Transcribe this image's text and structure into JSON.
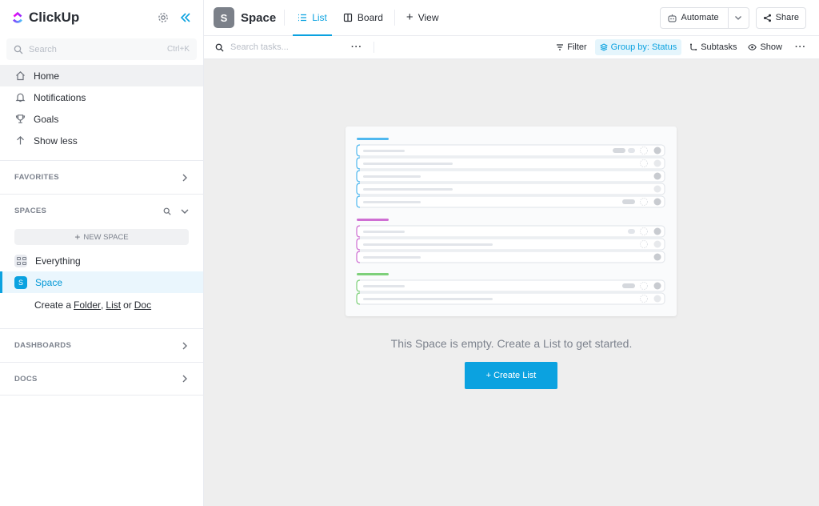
{
  "app": {
    "name": "ClickUp"
  },
  "sidebar": {
    "search_placeholder": "Search",
    "search_shortcut": "Ctrl+K",
    "nav": [
      {
        "label": "Home",
        "icon": "home-icon"
      },
      {
        "label": "Notifications",
        "icon": "bell-icon"
      },
      {
        "label": "Goals",
        "icon": "trophy-icon"
      },
      {
        "label": "Show less",
        "icon": "arrow-up-icon"
      }
    ],
    "favorites_label": "FAVORITES",
    "spaces_label": "SPACES",
    "new_space_label": "NEW SPACE",
    "spaces": [
      {
        "label": "Everything",
        "icon": "grid-icon"
      },
      {
        "label": "Space",
        "initial": "S"
      }
    ],
    "create_line": {
      "prefix": "Create a",
      "folder": "Folder",
      "comma": ",",
      "list": "List",
      "or": "or",
      "doc": "Doc"
    },
    "dashboards_label": "DASHBOARDS",
    "docs_label": "DOCS"
  },
  "header": {
    "space_initial": "S",
    "space_name": "Space",
    "tabs": [
      {
        "label": "List",
        "icon": "list-icon",
        "active": true
      },
      {
        "label": "Board",
        "icon": "board-icon",
        "active": false
      },
      {
        "label": "View",
        "icon": "plus-icon",
        "active": false
      }
    ],
    "automate_label": "Automate",
    "share_label": "Share"
  },
  "toolbar": {
    "search_placeholder": "Search tasks...",
    "filter_label": "Filter",
    "group_label": "Group by: Status",
    "subtasks_label": "Subtasks",
    "show_label": "Show"
  },
  "main": {
    "empty_message": "This Space is empty. Create a List to get started.",
    "create_button": "+ Create List"
  },
  "colors": {
    "accent": "#0ba2e0",
    "group1": "#4fb8ef",
    "group2": "#cf6fd3",
    "group3": "#7ed07a"
  }
}
